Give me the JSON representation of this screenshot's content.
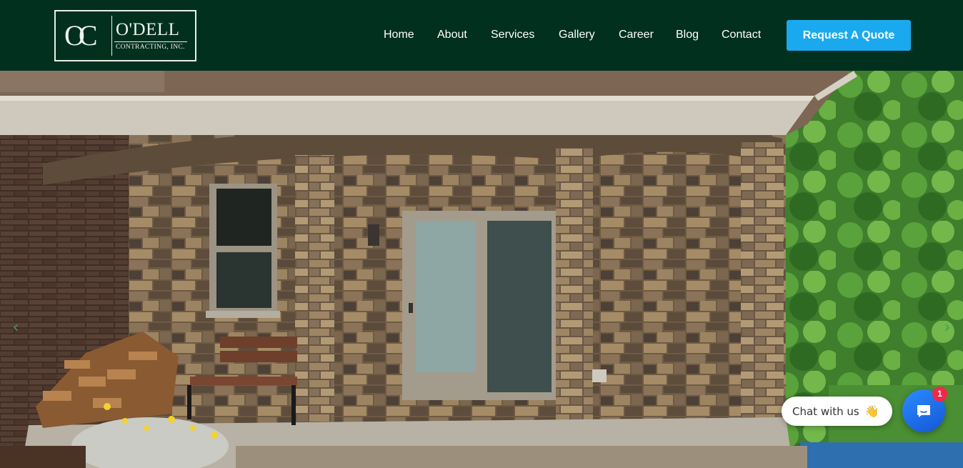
{
  "brand": {
    "mark": "OC",
    "name": "O'DELL",
    "subtitle": "CONTRACTING, INC."
  },
  "nav": {
    "items": [
      "Home",
      "About",
      "Services",
      "Gallery",
      "Career",
      "Blog",
      "Contact"
    ],
    "cta_label": "Request A Quote"
  },
  "hero": {
    "prev_arrow": "‹",
    "next_arrow": "›"
  },
  "chat": {
    "prompt_label": "Chat with us",
    "wave_icon": "👋",
    "unread_count": "1"
  },
  "colors": {
    "header_bg": "#02301f",
    "cta_bg": "#1aa9ef",
    "chat_launcher": "#1c6ff0",
    "badge": "#f02849"
  }
}
